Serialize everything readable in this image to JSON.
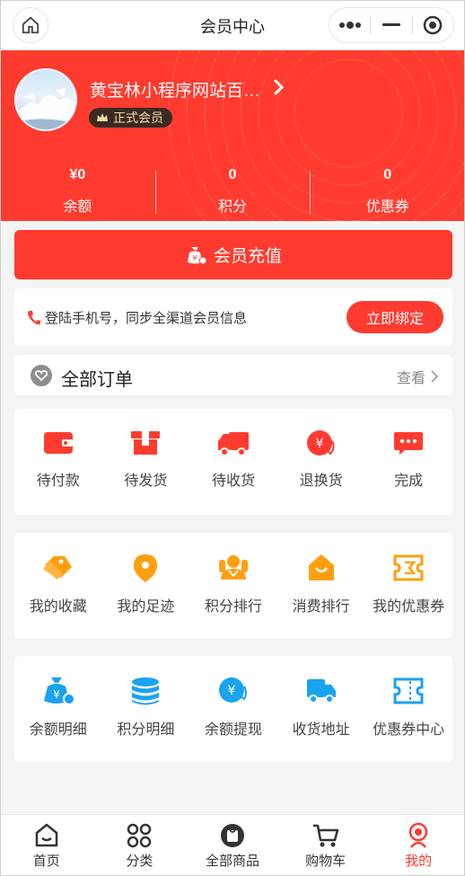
{
  "topbar": {
    "title": "会员中心",
    "home_icon": "home-icon",
    "capsule": [
      "more-dots-icon",
      "minimize-icon",
      "target-icon"
    ]
  },
  "user": {
    "name": "黄宝林小程序网站百…",
    "level": "正式会员"
  },
  "stats": [
    {
      "value": "¥0",
      "label": "余额"
    },
    {
      "value": "0",
      "label": "积分"
    },
    {
      "value": "0",
      "label": "优惠券"
    }
  ],
  "recharge": {
    "label": "会员充值"
  },
  "bind": {
    "text": "登陆手机号，同步全渠道会员信息",
    "button": "立即绑定"
  },
  "orders": {
    "title": "全部订单",
    "more": "查看",
    "items": [
      {
        "label": "待付款",
        "icon": "wallet-icon"
      },
      {
        "label": "待发货",
        "icon": "package-icon"
      },
      {
        "label": "待收货",
        "icon": "truck-icon"
      },
      {
        "label": "退换货",
        "icon": "refund-icon"
      },
      {
        "label": "完成",
        "icon": "chat-done-icon"
      }
    ]
  },
  "services": [
    {
      "label": "我的收藏",
      "icon": "tag-icon"
    },
    {
      "label": "我的足迹",
      "icon": "location-pin-icon"
    },
    {
      "label": "积分排行",
      "icon": "ranking-icon"
    },
    {
      "label": "消费排行",
      "icon": "shopping-bag-icon"
    },
    {
      "label": "我的优惠券",
      "icon": "ticket-icon"
    }
  ],
  "tools": [
    {
      "label": "余额明细",
      "icon": "money-bag-icon"
    },
    {
      "label": "积分明细",
      "icon": "coins-stack-icon"
    },
    {
      "label": "余额提现",
      "icon": "withdraw-icon"
    },
    {
      "label": "收货地址",
      "icon": "delivery-truck-icon"
    },
    {
      "label": "优惠券中心",
      "icon": "coupon-icon"
    }
  ],
  "tabbar": [
    {
      "label": "首页",
      "icon": "home-tab-icon"
    },
    {
      "label": "分类",
      "icon": "category-icon"
    },
    {
      "label": "全部商品",
      "icon": "all-goods-icon"
    },
    {
      "label": "购物车",
      "icon": "cart-icon"
    },
    {
      "label": "我的",
      "icon": "profile-icon"
    }
  ],
  "colors": {
    "brand_red": "#ff3b2f",
    "orange": "#ff9f0f",
    "blue": "#1aa3ee"
  }
}
